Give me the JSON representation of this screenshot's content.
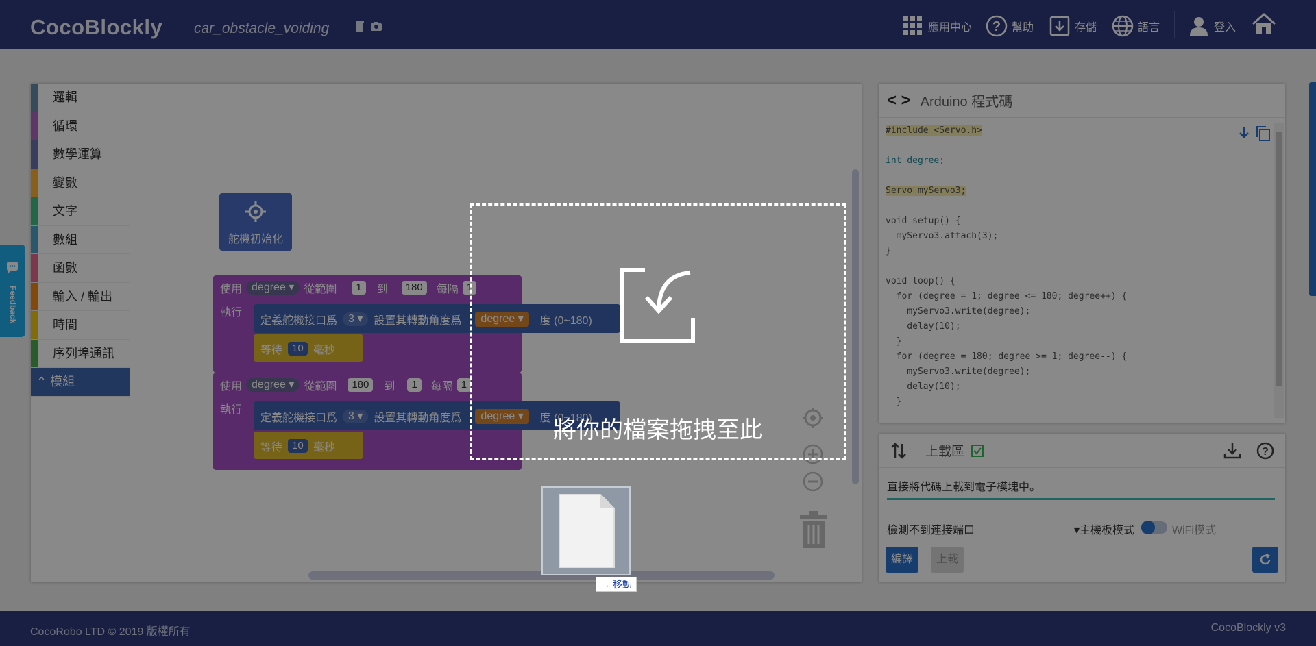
{
  "header": {
    "logo": "CocoBlockly",
    "project_title": "car_obstacle_voiding",
    "nav": [
      {
        "label": "應用中心",
        "icon": "grid-icon"
      },
      {
        "label": "幫助",
        "icon": "help-icon"
      },
      {
        "label": "存儲",
        "icon": "save-icon"
      },
      {
        "label": "語言",
        "icon": "globe-icon"
      },
      {
        "label": "登入",
        "icon": "user-icon"
      }
    ]
  },
  "toolbox": [
    {
      "label": "邏輯",
      "color": "#5b80a5"
    },
    {
      "label": "循環",
      "color": "#5ba55b"
    },
    {
      "label": "數學運算",
      "color": "#5b67a5"
    },
    {
      "label": "變數",
      "color": "#ffaa1f"
    },
    {
      "label": "文字",
      "color": "#5ba58c"
    },
    {
      "label": "數組",
      "color": "#5b9aa5"
    },
    {
      "label": "函數",
      "color": "#995ba5"
    },
    {
      "label": "輸入 / 輸出",
      "color": "#f57c00"
    },
    {
      "label": "時間",
      "color": "#f0c300"
    },
    {
      "label": "序列埠通訊",
      "color": "#3da642"
    },
    {
      "label": "模組",
      "color": "#2e5aa8"
    }
  ],
  "blocks": {
    "servo_init": "舵機初始化",
    "loop1": {
      "use": "使用",
      "var": "degree",
      "range": "從範圍",
      "from": "1",
      "to_label": "到",
      "to": "180",
      "step_label": "每隔",
      "step": "1",
      "exec": "執行"
    },
    "servo1": {
      "label": "定義舵機接口爲",
      "pin": "3",
      "set": "設置其轉動角度爲",
      "var": "degree",
      "unit": "度 (0~180)"
    },
    "wait1": {
      "label": "等待",
      "value": "10",
      "unit": "毫秒"
    },
    "loop2": {
      "use": "使用",
      "var": "degree",
      "range": "從範圍",
      "from": "180",
      "to_label": "到",
      "to": "1",
      "step_label": "每隔",
      "step": "1",
      "exec": "執行"
    },
    "servo2": {
      "label": "定義舵機接口爲",
      "pin": "3",
      "set": "設置其轉動角度爲",
      "var": "degree",
      "unit": "度 (0~180)"
    },
    "wait2": {
      "label": "等待",
      "value": "10",
      "unit": "毫秒"
    }
  },
  "code_panel": {
    "arrows": "< >",
    "title": "Arduino 程式碼",
    "lines": [
      "#include <Servo.h>",
      "",
      "int degree;",
      "",
      "Servo myServo3;",
      "",
      "void setup() {",
      "  myServo3.attach(3);",
      "}",
      "",
      "void loop() {",
      "  for (degree = 1; degree <= 180; degree++) {",
      "    myServo3.write(degree);",
      "    delay(10);",
      "  }",
      "  for (degree = 180; degree >= 1; degree--) {",
      "    myServo3.write(degree);",
      "    delay(10);",
      "  }"
    ]
  },
  "upload_panel": {
    "title": "上載區",
    "message": "直接將代碼上載到電子模塊中。",
    "port": "檢測不到連接端口",
    "mode_main": "▾主機板模式",
    "mode_wifi": "WiFi模式",
    "compile": "編譯",
    "upload": "上載"
  },
  "feedback": "Feedback",
  "overlay": {
    "drop_text": "將你的檔案拖拽至此",
    "move_tag": "移動"
  },
  "footer": {
    "copyright": "CocoRobo LTD © 2019 版權所有",
    "version": "CocoBlockly v3"
  }
}
